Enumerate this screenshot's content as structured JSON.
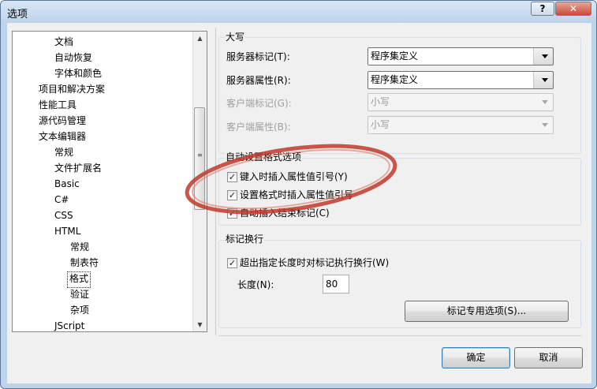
{
  "window": {
    "title": "选项",
    "help_glyph": "?",
    "close_glyph": "✕"
  },
  "tree": {
    "items": [
      {
        "label": "文档"
      },
      {
        "label": "自动恢复"
      },
      {
        "label": "字体和颜色"
      },
      {
        "label": "项目和解决方案"
      },
      {
        "label": "性能工具"
      },
      {
        "label": "源代码管理"
      },
      {
        "label": "文本编辑器"
      },
      {
        "label": "常规"
      },
      {
        "label": "文件扩展名"
      },
      {
        "label": "Basic"
      },
      {
        "label": "C#"
      },
      {
        "label": "CSS"
      },
      {
        "label": "HTML"
      },
      {
        "label": "常规"
      },
      {
        "label": "制表符"
      },
      {
        "label": "格式"
      },
      {
        "label": "验证"
      },
      {
        "label": "杂项"
      },
      {
        "label": "JScript"
      }
    ],
    "selected": "格式",
    "scroll_up": "▲",
    "scroll_down": "▼"
  },
  "case_group": {
    "title": "大写",
    "server_tag_label": "服务器标记(T):",
    "server_tag_value": "程序集定义",
    "server_attr_label": "服务器属性(R):",
    "server_attr_value": "程序集定义",
    "client_tag_label": "客户端标记(G):",
    "client_tag_value": "小写",
    "client_attr_label": "客户端属性(B):",
    "client_attr_value": "小写"
  },
  "autoformat_group": {
    "title": "自动设置格式选项",
    "opt_quotes_label": "键入时插入属性值引号(Y)",
    "opt_quotes_checked": true,
    "opt_format_quotes_label": "设置格式时插入属性值引号",
    "opt_format_quotes_checked": true,
    "opt_close_tag_label": "自动插入结束标记(C)",
    "opt_close_tag_checked": true
  },
  "wrap_group": {
    "title": "标记换行",
    "wrap_label": "超出指定长度时对标记执行换行(W)",
    "wrap_checked": true,
    "length_label": "长度(N):",
    "length_value": "80",
    "tag_options_button": "标记专用选项(S)..."
  },
  "footer": {
    "ok_label": "确定",
    "cancel_label": "取消"
  },
  "checkmark": "✓",
  "colors": {
    "highlight_ellipse": "#c0392b",
    "title_bar": "#bfd5ec",
    "close_button": "#c94a33"
  }
}
